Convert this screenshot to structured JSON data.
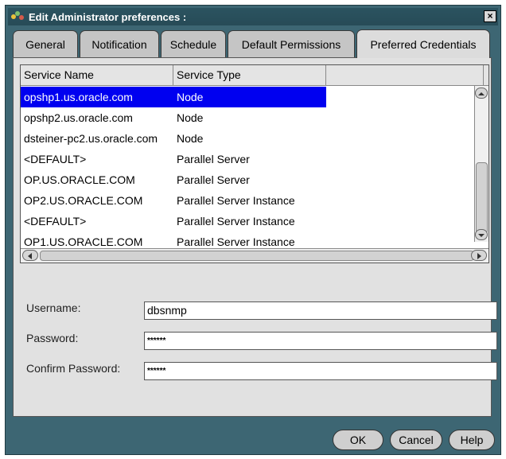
{
  "window": {
    "title": "Edit Administrator preferences :",
    "close_label": "×"
  },
  "tabs": [
    {
      "label": "General"
    },
    {
      "label": "Notification"
    },
    {
      "label": "Schedule"
    },
    {
      "label": "Default Permissions"
    },
    {
      "label": "Preferred Credentials",
      "active": true
    }
  ],
  "table": {
    "columns": [
      "Service Name",
      "Service Type"
    ],
    "rows": [
      {
        "name": "opshp1.us.oracle.com",
        "type": "Node",
        "selected": true
      },
      {
        "name": "opshp2.us.oracle.com",
        "type": "Node"
      },
      {
        "name": "dsteiner-pc2.us.oracle.com",
        "type": "Node"
      },
      {
        "name": "<DEFAULT>",
        "type": "Parallel Server"
      },
      {
        "name": "OP.US.ORACLE.COM",
        "type": "Parallel Server"
      },
      {
        "name": "OP2.US.ORACLE.COM",
        "type": "Parallel Server Instance"
      },
      {
        "name": "<DEFAULT>",
        "type": "Parallel Server Instance"
      },
      {
        "name": "OP1.US.ORACLE.COM",
        "type": "Parallel Server Instance"
      }
    ]
  },
  "form": {
    "username_label": "Username:",
    "username_value": "dbsnmp",
    "password_label": "Password:",
    "password_value": "******",
    "confirm_label": "Confirm Password:",
    "confirm_value": "******"
  },
  "buttons": {
    "ok": "OK",
    "cancel": "Cancel",
    "help": "Help"
  }
}
